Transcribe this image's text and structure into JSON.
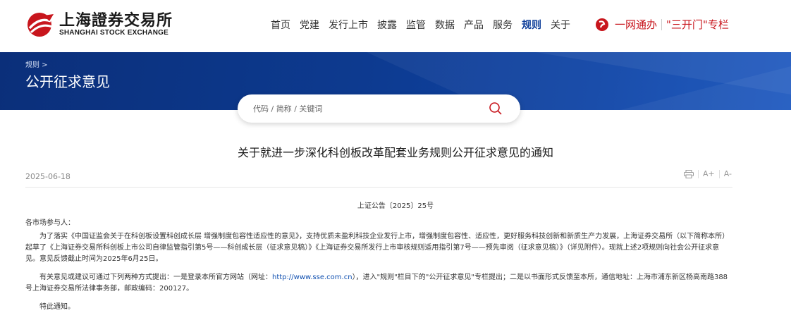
{
  "logo": {
    "cn": "上海證券交易所",
    "en": "SHANGHAI STOCK EXCHANGE"
  },
  "nav": [
    "首页",
    "党建",
    "发行上市",
    "披露",
    "监管",
    "数据",
    "产品",
    "服务",
    "规则",
    "关于"
  ],
  "nav_active": "规则",
  "promo": {
    "left": "一网通办",
    "right": "\"三开门\"专栏"
  },
  "breadcrumb": "规则 >",
  "page_title": "公开征求意见",
  "search": {
    "placeholder": "代码 / 简称 / 关键词"
  },
  "article": {
    "title": "关于就进一步深化科创板改革配套业务规则公开征求意见的通知",
    "date": "2025-06-18",
    "tools": {
      "print": "print-icon",
      "font_up": "A+",
      "font_down": "A-"
    },
    "doc_no": "上证公告〔2025〕25号",
    "greeting": "各市场参与人：",
    "p1": "为了落实《中国证监会关于在科创板设置科创成长层 增强制度包容性适应性的意见》，支持优质未盈利科技企业发行上市，增强制度包容性、适应性，更好服务科技创新和新质生产力发展，上海证券交易所（以下简称本所）起草了《上海证券交易所科创板上市公司自律监管指引第5号——科创成长层（征求意见稿）》《上海证券交易所发行上市审核规则适用指引第7号——预先审阅（征求意见稿）》（详见附件）。现就上述2项规则向社会公开征求意见。意见反馈截止时间为2025年6月25日。",
    "p2_a": "有关意见或建议可通过下列两种方式提出：一是登录本所官方网站（网址：",
    "p2_link": "http://www.sse.com.cn",
    "p2_b": "），进入\"规则\"栏目下的\"公开征求意见\"专栏提出；二是以书面形式反馈至本所，通信地址：上海市浦东新区杨高南路388号上海证券交易所法律事务部，邮政编码：200127。",
    "p3": "特此通知。"
  },
  "colors": {
    "brand_red": "#c8161d",
    "nav_active": "#0f3f9a",
    "banner": "#0d3a8f",
    "link": "#0f4fb0"
  }
}
